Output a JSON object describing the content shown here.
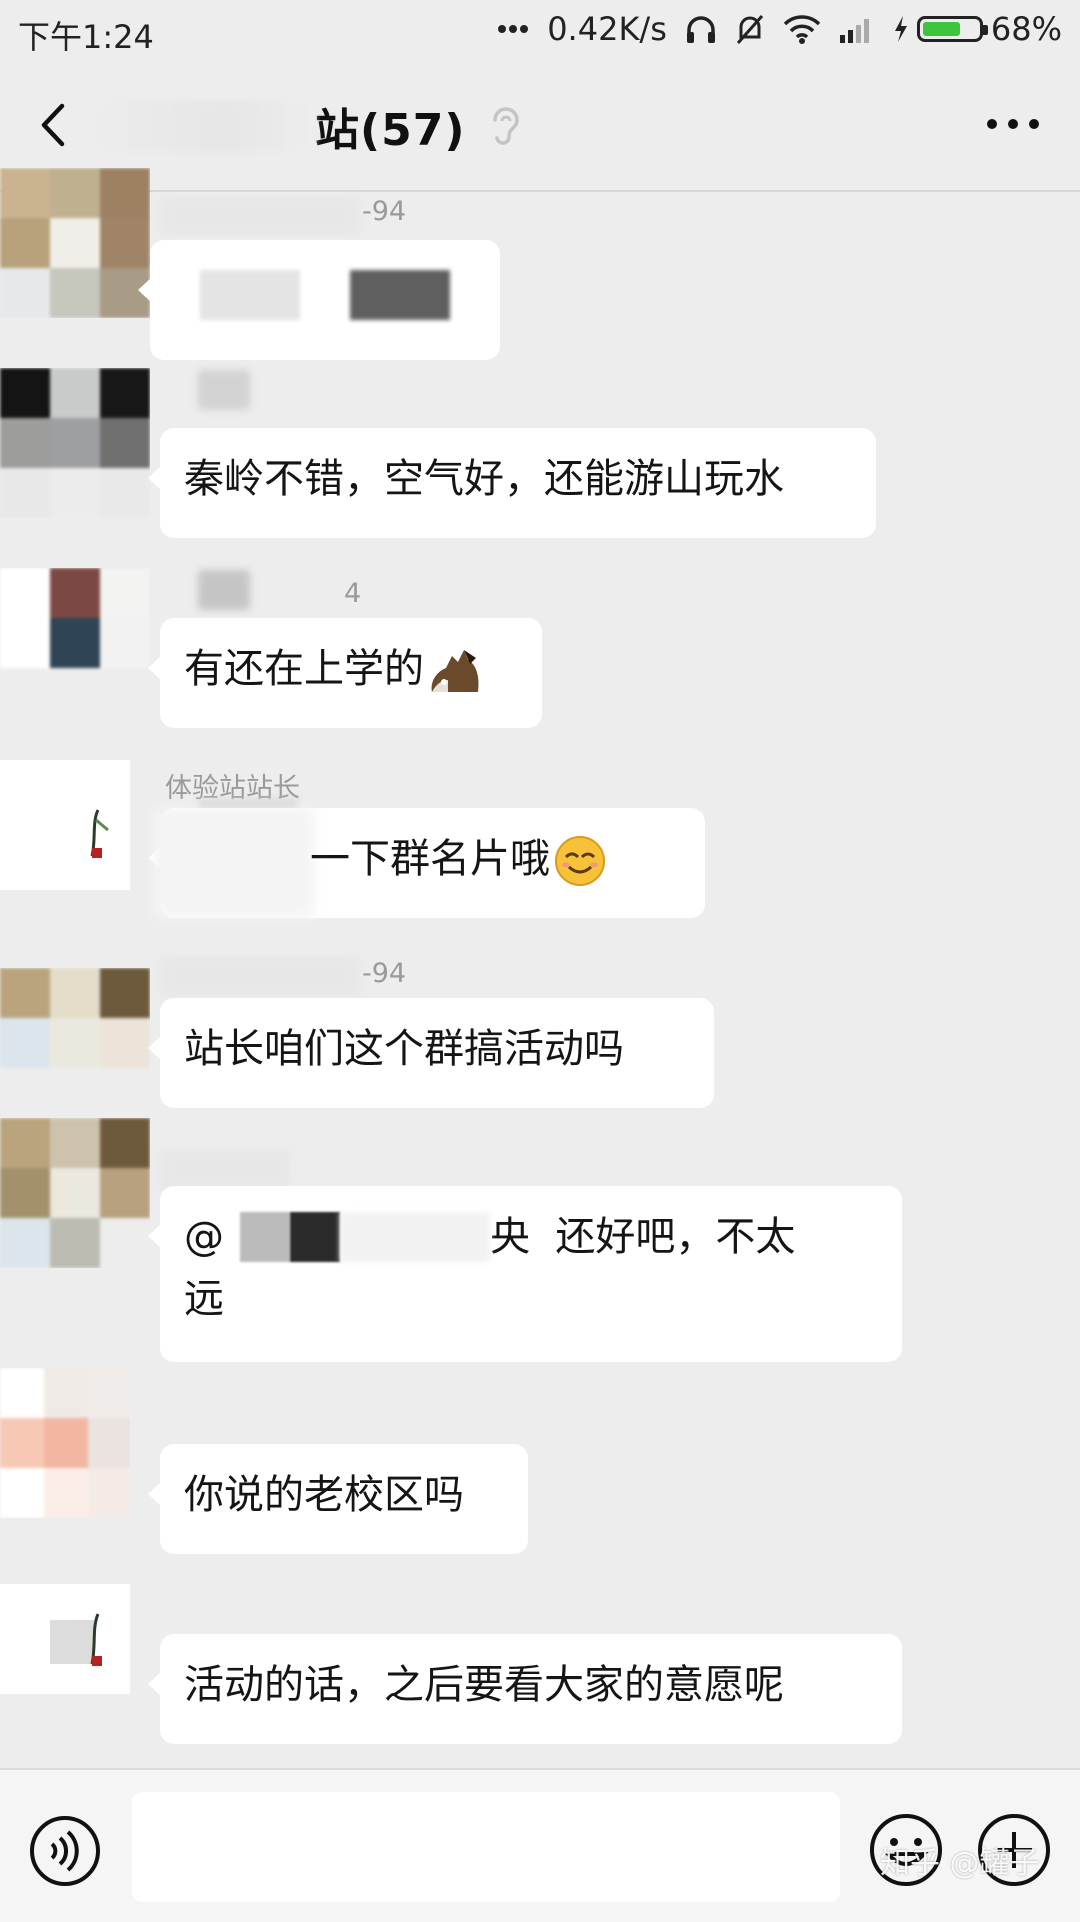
{
  "status_bar": {
    "time": "下午1:24",
    "net_speed": "0.42K/s",
    "battery_percent": "68%",
    "battery_level": 0.68
  },
  "header": {
    "title": "站(57)"
  },
  "messages": [
    {
      "sender": "-94",
      "text": ""
    },
    {
      "sender": "",
      "text": "秦岭不错，空气好，还能游山玩水"
    },
    {
      "sender": "4",
      "text": "有还在上学的"
    },
    {
      "sender": "体验站站长",
      "text": "一下群名片哦"
    },
    {
      "sender": "-94",
      "text": "站长咱们这个群搞活动吗"
    },
    {
      "sender": "",
      "text_line1": "@",
      "text_mid": "央  还好吧，不太",
      "text_line2": "远"
    },
    {
      "sender": "",
      "text": "你说的老校区吗"
    },
    {
      "sender": "",
      "text": "活动的话，之后要看大家的意愿呢"
    }
  ],
  "watermark": "知乎 @罐子",
  "icons": [
    "back-icon",
    "ear-icon",
    "more-icon",
    "voice-icon",
    "emoji-icon",
    "plus-icon",
    "horse-emoji",
    "smile-emoji"
  ]
}
